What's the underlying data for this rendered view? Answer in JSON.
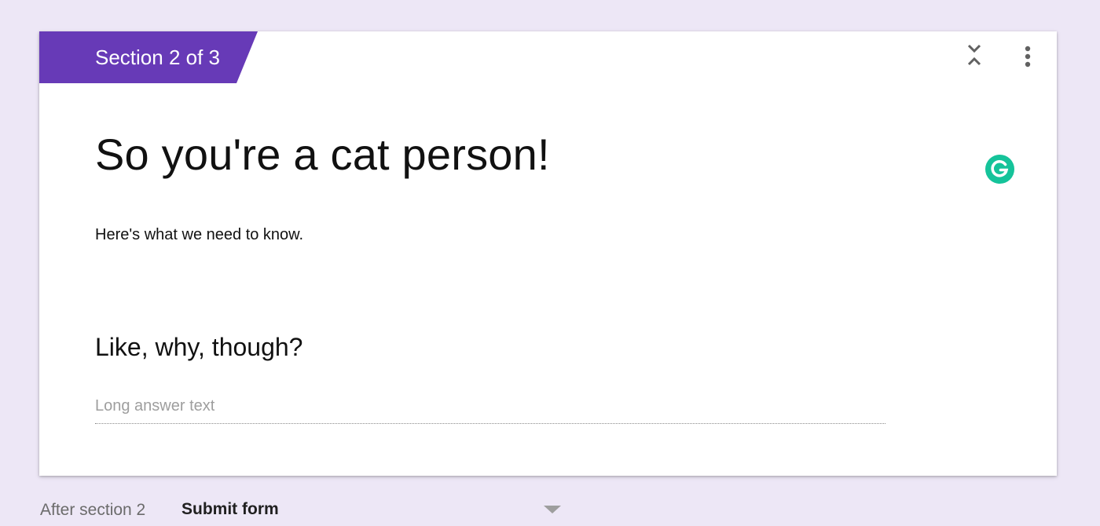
{
  "section": {
    "tab_label": "Section 2 of 3",
    "title": "So you're a cat person!",
    "description": "Here's what we need to know."
  },
  "question": {
    "title": "Like, why, though?",
    "answer_placeholder": "Long answer text"
  },
  "footer": {
    "after_label": "After section 2",
    "after_value": "Submit form"
  },
  "icons": {
    "collapse": "collapse-icon",
    "more": "more-vert-icon",
    "grammarly": "grammarly-icon",
    "dropdown": "dropdown-arrow-icon"
  },
  "colors": {
    "background": "#ede7f6",
    "accent": "#673ab7",
    "grammarly": "#15c39a"
  }
}
